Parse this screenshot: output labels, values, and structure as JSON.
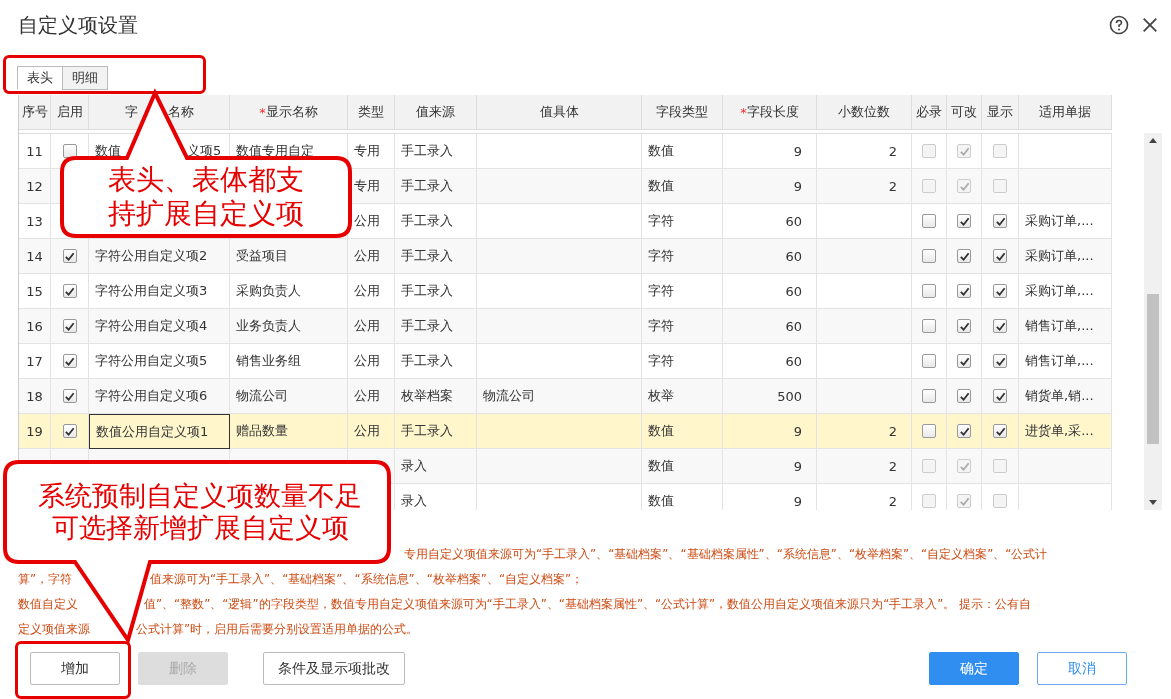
{
  "window": {
    "title": "自定义项设置"
  },
  "tabs": [
    {
      "label": "表头",
      "selected": true
    },
    {
      "label": "明细",
      "selected": false
    }
  ],
  "table": {
    "columns": [
      {
        "label": "序号"
      },
      {
        "label": "启用"
      },
      {
        "label_parts": [
          "字",
          "名称"
        ]
      },
      {
        "label": "显示名称",
        "required_mark": "*"
      },
      {
        "label": "类型"
      },
      {
        "label": "值来源"
      },
      {
        "label": "值具体"
      },
      {
        "label": "字段类型"
      },
      {
        "label": "字段长度",
        "required_mark": "*"
      },
      {
        "label": "小数位数"
      },
      {
        "label": "必录"
      },
      {
        "label": "可改"
      },
      {
        "label": "显示"
      },
      {
        "label": "适用单据"
      }
    ],
    "rows": [
      {
        "no": "11",
        "enabled": false,
        "name_parts": [
          "数值",
          "义项5"
        ],
        "display": "数值专用自定",
        "type": "专用",
        "source": "手工录入",
        "field_type": "数值",
        "length": "9",
        "decimals": "2",
        "required": false,
        "editable": true,
        "shown": false,
        "locked": true,
        "selected": false
      },
      {
        "no": "12",
        "type": "专用",
        "source": "手工录入",
        "field_type": "数值",
        "length": "9",
        "decimals": "2",
        "required": false,
        "editable": true,
        "shown": false,
        "locked": true,
        "selected": false
      },
      {
        "no": "13",
        "type": "公用",
        "source": "手工录入",
        "field_type": "字符",
        "length": "60",
        "required": false,
        "editable": true,
        "shown": true,
        "locked": false,
        "docs": "采购订单,...",
        "selected": false
      },
      {
        "no": "14",
        "enabled": true,
        "name": "字符公用自定义项2",
        "display": "受益项目",
        "type": "公用",
        "source": "手工录入",
        "field_type": "字符",
        "length": "60",
        "required": false,
        "editable": true,
        "shown": true,
        "locked": false,
        "docs": "采购订单,...",
        "selected": false
      },
      {
        "no": "15",
        "enabled": true,
        "name": "字符公用自定义项3",
        "display": "采购负责人",
        "type": "公用",
        "source": "手工录入",
        "field_type": "字符",
        "length": "60",
        "required": false,
        "editable": true,
        "shown": true,
        "locked": false,
        "docs": "采购订单,...",
        "selected": false
      },
      {
        "no": "16",
        "enabled": true,
        "name": "字符公用自定义项4",
        "display": "业务负责人",
        "type": "公用",
        "source": "手工录入",
        "field_type": "字符",
        "length": "60",
        "required": false,
        "editable": true,
        "shown": true,
        "locked": false,
        "docs": "销售订单,...",
        "selected": false
      },
      {
        "no": "17",
        "enabled": true,
        "name": "字符公用自定义项5",
        "display": "销售业务组",
        "type": "公用",
        "source": "手工录入",
        "field_type": "字符",
        "length": "60",
        "required": false,
        "editable": true,
        "shown": true,
        "locked": false,
        "docs": "销售订单,...",
        "selected": false
      },
      {
        "no": "18",
        "enabled": true,
        "name": "字符公用自定义项6",
        "display": "物流公司",
        "type": "公用",
        "source": "枚举档案",
        "source_detail": "物流公司",
        "field_type": "枚举",
        "length": "500",
        "required": false,
        "editable": true,
        "shown": true,
        "locked": false,
        "docs": "销货单,销...",
        "selected": false
      },
      {
        "no": "19",
        "enabled": true,
        "name": "数值公用自定义项1",
        "display": "赠品数量",
        "type": "公用",
        "source": "手工录入",
        "field_type": "数值",
        "length": "9",
        "decimals": "2",
        "required": false,
        "editable": true,
        "shown": true,
        "locked": false,
        "docs": "进货单,采...",
        "selected": true
      },
      {
        "source": "录入",
        "field_type": "数值",
        "length": "9",
        "decimals": "2",
        "required": false,
        "editable": true,
        "shown": false,
        "locked": true,
        "selected": false
      },
      {
        "source": "录入",
        "field_type": "数值",
        "length": "9",
        "decimals": "2",
        "required": false,
        "editable": true,
        "shown": false,
        "locked": true,
        "selected": false
      }
    ]
  },
  "notes": [
    {
      "right": "专用自定义项值来源可为“手工录入”、“基础档案”、“基础档案属性”、“系统信息”、“枚举档案”、“自定义档案”、“公式计"
    },
    {
      "left": "算”，字符",
      "right": "值来源可为“手工录入”、“基础档案”、“系统信息”、“枚举档案”、“自定义档案”；"
    },
    {
      "left": "数值自定义",
      "right": "值”、“整数”、“逻辑”的字段类型，数值专用自定义项值来源可为“手工录入”、“基础档案属性”、“公式计算”，数值公用自定义项值来源只为“手工录入”。 提示：公有自"
    },
    {
      "left": "定义项值来源",
      "right": "公式计算”时，启用后需要分别设置适用单据的公式。"
    }
  ],
  "left_buttons": [
    {
      "label": "增加",
      "disabled": false
    },
    {
      "label": "删除",
      "disabled": true
    },
    {
      "label": "条件及显示项批改",
      "disabled": false
    }
  ],
  "right_buttons": [
    {
      "label": "确定",
      "kind": "primary"
    },
    {
      "label": "取消",
      "kind": "cancel"
    }
  ],
  "callouts": [
    {
      "text": "表头、表体都支持扩展自定义项"
    },
    {
      "text": "系统预制自定义项数量不足可选择新增扩展自定义项"
    }
  ]
}
